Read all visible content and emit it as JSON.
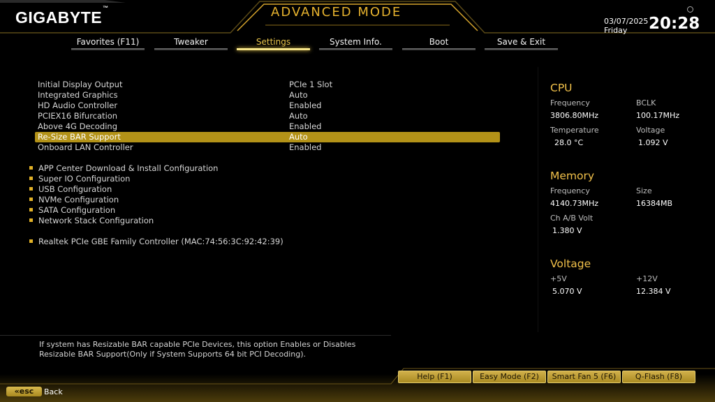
{
  "header": {
    "logo": "GIGABYTE",
    "logo_mark": "™",
    "mode_title": "ADVANCED MODE",
    "date": "03/07/2025",
    "day": "Friday",
    "time": "20:28"
  },
  "tabs": [
    {
      "label": "Favorites (F11)"
    },
    {
      "label": "Tweaker"
    },
    {
      "label": "Settings",
      "active": true
    },
    {
      "label": "System Info."
    },
    {
      "label": "Boot"
    },
    {
      "label": "Save & Exit"
    }
  ],
  "settings": [
    {
      "label": "Initial Display Output",
      "value": "PCIe 1 Slot"
    },
    {
      "label": "Integrated Graphics",
      "value": "Auto"
    },
    {
      "label": "HD Audio Controller",
      "value": "Enabled"
    },
    {
      "label": "PCIEX16 Bifurcation",
      "value": "Auto"
    },
    {
      "label": "Above 4G Decoding",
      "value": "Enabled"
    },
    {
      "label": "Re-Size BAR Support",
      "value": "Auto",
      "selected": true
    },
    {
      "label": "Onboard LAN Controller",
      "value": "Enabled"
    }
  ],
  "submenus": [
    "APP Center Download & Install Configuration",
    "Super IO Configuration",
    "USB Configuration",
    "NVMe Configuration",
    "SATA Configuration",
    "Network Stack Configuration"
  ],
  "lan_item": "Realtek PCIe GBE Family Controller (MAC:74:56:3C:92:42:39)",
  "cpu": {
    "title": "CPU",
    "frequency_label": "Frequency",
    "frequency": "3806.80MHz",
    "bclk_label": "BCLK",
    "bclk": "100.17MHz",
    "temperature_label": "Temperature",
    "temperature": "28.0 °C",
    "voltage_label": "Voltage",
    "voltage": "1.092 V"
  },
  "memory": {
    "title": "Memory",
    "frequency_label": "Frequency",
    "frequency": "4140.73MHz",
    "size_label": "Size",
    "size": "16384MB",
    "volt_label": "Ch A/B Volt",
    "volt": "1.380 V"
  },
  "voltage": {
    "title": "Voltage",
    "v5_label": "+5V",
    "v5": "5.070 V",
    "v12_label": "+12V",
    "v12": "12.384 V"
  },
  "help": {
    "line1": "If system has Resizable BAR capable PCIe Devices, this option Enables or Disables",
    "line2": "Resizable BAR Support(Only if System Supports 64 bit PCI Decoding)."
  },
  "function_buttons": [
    "Help (F1)",
    "Easy Mode (F2)",
    "Smart Fan 5 (F6)",
    "Q-Flash (F8)"
  ],
  "esc": {
    "key": "esc",
    "label": "Back"
  },
  "colors": {
    "accent": "#e6b22e",
    "selected_bg": "#b39218",
    "tab_active": "#e8c44a"
  }
}
